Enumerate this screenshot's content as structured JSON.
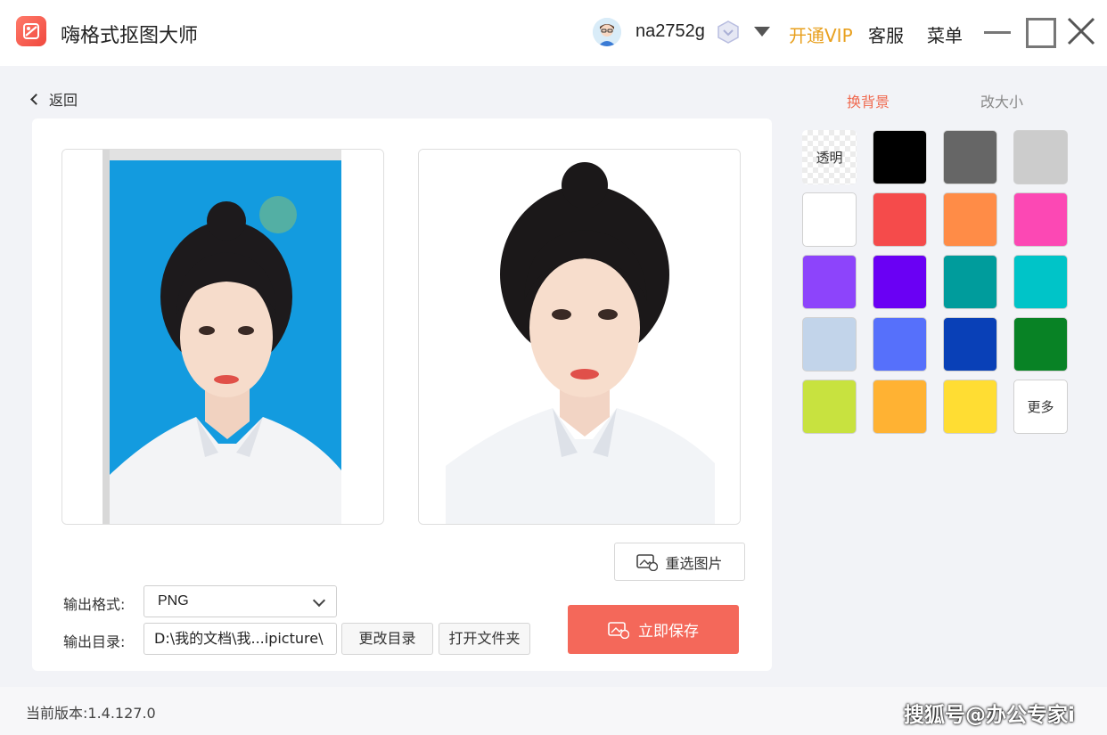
{
  "app": {
    "title": "嗨格式抠图大师",
    "logo_icon": "scissors-logo-icon"
  },
  "header": {
    "username": "na2752g",
    "vip_label": "开通VIP",
    "service_label": "客服",
    "menu_label": "菜单",
    "vip_color": "#e8a01e"
  },
  "nav": {
    "back_label": "返回"
  },
  "preview": {
    "original_image": "portrait-blue-background",
    "result_image": "portrait-cutout"
  },
  "actions": {
    "reselect_label": "重选图片",
    "save_label": "立即保存",
    "change_dir_label": "更改目录",
    "open_folder_label": "打开文件夹",
    "save_color": "#f4685a"
  },
  "output": {
    "format_label": "输出格式:",
    "format_value": "PNG",
    "dir_label": "输出目录:",
    "dir_value": "D:\\我的文档\\我...ipicture\\"
  },
  "panel": {
    "tabs": [
      {
        "label": "换背景",
        "active": true
      },
      {
        "label": "改大小",
        "active": false
      }
    ],
    "swatches": [
      {
        "label": "透明",
        "color": "transparent"
      },
      {
        "label": "",
        "color": "#000000"
      },
      {
        "label": "",
        "color": "#666666"
      },
      {
        "label": "",
        "color": "#cccccc"
      },
      {
        "label": "",
        "color": "#ffffff"
      },
      {
        "label": "",
        "color": "#f54b4b"
      },
      {
        "label": "",
        "color": "#ff8c47"
      },
      {
        "label": "",
        "color": "#fc48b4"
      },
      {
        "label": "",
        "color": "#8d44fb"
      },
      {
        "label": "",
        "color": "#6a00f4"
      },
      {
        "label": "",
        "color": "#009c9c"
      },
      {
        "label": "",
        "color": "#00c4c8"
      },
      {
        "label": "",
        "color": "#c2d4ea"
      },
      {
        "label": "",
        "color": "#5670fb"
      },
      {
        "label": "",
        "color": "#0940b7"
      },
      {
        "label": "",
        "color": "#088225"
      },
      {
        "label": "",
        "color": "#c8e23f"
      },
      {
        "label": "",
        "color": "#ffb233"
      },
      {
        "label": "",
        "color": "#ffdd33"
      },
      {
        "label": "更多",
        "color": "#ffffff"
      }
    ]
  },
  "footer": {
    "version_text": "当前版本:1.4.127.0",
    "watermark": "搜狐号@办公专家i"
  }
}
